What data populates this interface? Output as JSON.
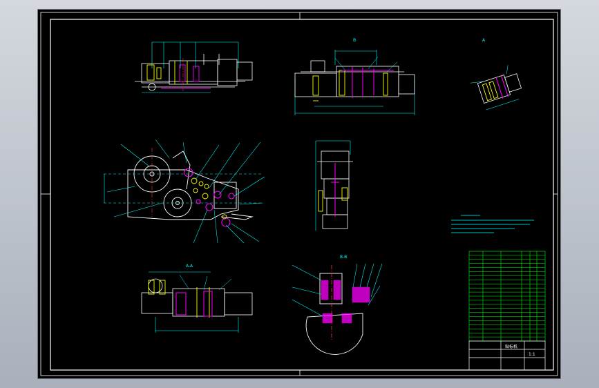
{
  "colors": {
    "background": "#000000",
    "frame": "#ffffff",
    "outline": "#ffffff",
    "dimension": "#00ffff",
    "section": "#ff00ff",
    "centerline": "#ff3333",
    "leader": "#00ffff",
    "component": "#ffff00",
    "table": "#00ff00",
    "note": "#00ffff"
  },
  "views": {
    "top_left": "top-view",
    "top_center": "front-view",
    "top_right": "detail-view",
    "middle_left": "side-view-mechanism",
    "middle_center": "end-view",
    "bottom_left": "bottom-view",
    "bottom_center": "section-view"
  },
  "view_labels": {
    "top_center": "B",
    "top_right": "A",
    "bottom_left": "A-A",
    "bottom_center": "B-B"
  },
  "title_block": {
    "drawing_name": "贴标机",
    "scale": "1:1"
  }
}
